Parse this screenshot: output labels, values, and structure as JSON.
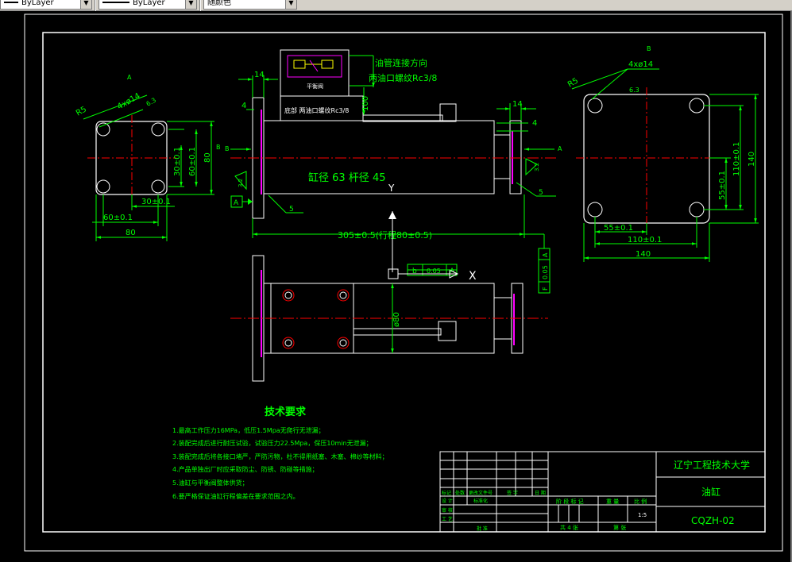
{
  "toolbar": {
    "linetype_label": "ByLayer",
    "lineweight_label": "ByLayer",
    "color_label": "随颜色"
  },
  "drawing": {
    "views": {
      "left": {
        "label": "A",
        "dim_radius": "R5",
        "dim_holes": "4xø14",
        "dim_roughness": "6.3",
        "dim_30_v": "30±0.1",
        "dim_60_v": "60±0.1",
        "dim_80_v": "80",
        "dim_30_h": "30±0.1",
        "dim_60_h": "60±0.1",
        "dim_80_h": "80",
        "view_mark": "B"
      },
      "center": {
        "valve_label": "平衡阀",
        "note_oil_pipe": "油管连接方向",
        "note_oil_port": "两油口螺纹Rc3/8",
        "inner_note": "底部  两油口螺纹Rc3/8",
        "dim_14_left": "14",
        "dim_4_left": "4",
        "dim_100": "100",
        "dim_14_right": "14",
        "dim_4_right": "4",
        "bore_label": "缸径 63  杆径 45",
        "roughness_left": "3.2",
        "roughness_right": "3.2",
        "datum_a": "A",
        "arrow_a": "A",
        "arrow_b": "B",
        "dim_5_left": "5",
        "dim_5_right": "5",
        "dim_total": "305±0.5(行程80±0.5)",
        "rough_y": "Y",
        "tol_frame": [
          "b",
          "0.05",
          "A"
        ],
        "perp_frame": [
          "F",
          "0.05",
          "A"
        ],
        "mark_x": "X",
        "dim_phi80": "ø80"
      },
      "right": {
        "label": "B",
        "dim_radius": "R5",
        "dim_holes": "4xø14",
        "dim_roughness": "6.3",
        "dim_55_v": "55±0.1",
        "dim_110_v": "110±0.1",
        "dim_140_v": "140",
        "dim_55_h": "55±0.1",
        "dim_110_h": "110±0.1",
        "dim_140_h": "140"
      }
    },
    "tech": {
      "title": "技术要求",
      "items": [
        "1.最高工作压力16MPa，低压1.5Mpa无爬行无泄漏；",
        "2.装配完成后进行耐压试验，试验压力22.5Mpa，保压10min无泄漏；",
        "3.装配完成后将各接口堵严，严防污物，杜不得用纸塞、木塞、棉纱等材料；",
        "4.产品单独出厂时应采取防尘、防锈、防碰等措施；",
        "5.油缸与平衡阀整体供货；",
        "6.要严格保证油缸行程偏差在要求范围之内。"
      ]
    },
    "titleblock": {
      "school": "辽宁工程技术大学",
      "part_name": "油缸",
      "drawing_no": "CQZH-02",
      "scale": "1:5",
      "rev_headers": [
        "标记",
        "处数",
        "更改文件号",
        "签 字",
        "日 期"
      ],
      "row_labels": [
        "设 计",
        "标准化"
      ],
      "review": "审 核",
      "process": "工 艺",
      "approve": "批 准",
      "stage_label": "阶 段 标 记",
      "weight_label": "重 量",
      "scale_label": "比 例",
      "sheets": "共  4  张",
      "sheet_no": "第  张"
    }
  },
  "colors": {
    "background": "#000000",
    "frame": "#ffffff",
    "dimension": "#00ff00",
    "centerline": "#ff0000",
    "hidden": "#ff00ff",
    "text": "#ffffff",
    "note": "#00ff00"
  }
}
